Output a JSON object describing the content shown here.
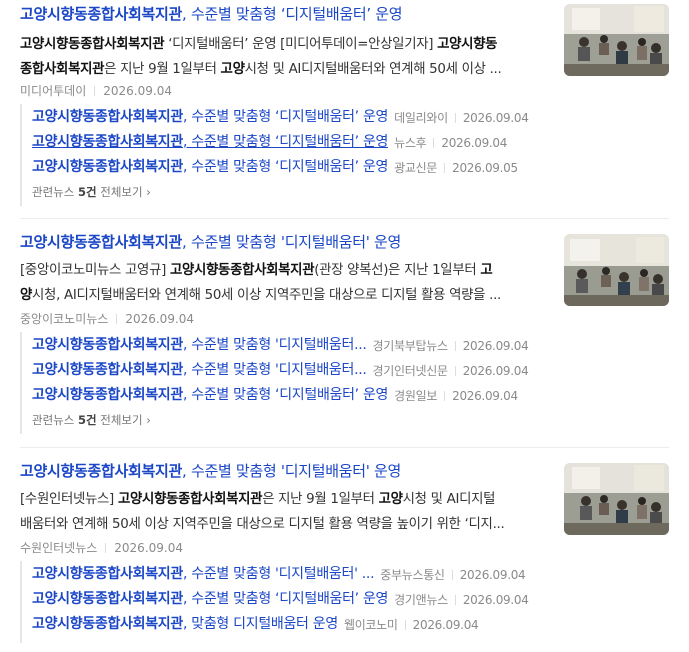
{
  "results": [
    {
      "title_strong": "고양시향동종합사회복지관",
      "title_rest": ", 수준별 맞춤형 ‘디지털배움터’ 운영",
      "desc_lines": [
        [
          [
            "b",
            "고양시향동종합사회복지관"
          ],
          [
            "t",
            " ‘디지털배움터’ 운영 [미디어투데이=안상일기자] "
          ],
          [
            "b",
            "고양시향동"
          ]
        ],
        [
          [
            "b",
            "종합사회복지관"
          ],
          [
            "t",
            "은 지난 9월 1일부터 "
          ],
          [
            "b",
            "고양"
          ],
          [
            "t",
            "시청 및 AI디지털배움터와 연계해 50세 이상 ..."
          ]
        ]
      ],
      "source": "미디어투데이",
      "date": "2026.09.04",
      "related": [
        {
          "strong": "고양시향동종합사회복지관",
          "rest": ", 수준별 맞춤형 ‘디지털배움터’ 운영",
          "src": "데일리와이",
          "date": "2026.09.04",
          "underline": false
        },
        {
          "strong": "고양시향동종합사회복지관",
          "rest": ", 수준별 맞춤형 ‘디지털배움터’ 운영",
          "src": "뉴스후",
          "date": "2026.09.04",
          "underline": true
        },
        {
          "strong": "고양시향동종합사회복지관",
          "rest": ", 수준별 맞춤형 ‘디지털배움터’ 운영",
          "src": "광교신문",
          "date": "2026.09.05",
          "underline": false
        }
      ],
      "more_prefix": "관련뉴스 ",
      "more_count": "5건",
      "more_suffix": " 전체보기"
    },
    {
      "title_strong": "고양시향동종합사회복지관",
      "title_rest": ", 수준별 맞춤형 '디지털배움터' 운영",
      "desc_lines": [
        [
          [
            "t",
            "[중앙이코노미뉴스 고영규] "
          ],
          [
            "b",
            "고양시향동종합사회복지관"
          ],
          [
            "t",
            "(관장 양복선)은 지난 1일부터 "
          ],
          [
            "b",
            "고"
          ]
        ],
        [
          [
            "b",
            "양"
          ],
          [
            "t",
            "시청, AI디지털배움터와 연계해 50세 이상 지역주민을 대상으로 디지털 활용 역량을 ..."
          ]
        ]
      ],
      "source": "중앙이코노미뉴스",
      "date": "2026.09.04",
      "related": [
        {
          "strong": "고양시향동종합사회복지관",
          "rest": ", 수준별 맞춤형 '디지털배움터...",
          "src": "경기북부탑뉴스",
          "date": "2026.09.04",
          "underline": false
        },
        {
          "strong": "고양시향동종합사회복지관",
          "rest": ", 수준별 맞춤형 '디지털배움터...",
          "src": "경기인터넷신문",
          "date": "2026.09.04",
          "underline": false
        },
        {
          "strong": "고양시향동종합사회복지관",
          "rest": ", 수준별 맞춤형 ‘디지털배움터’ 운영",
          "src": "경원일보",
          "date": "2026.09.04",
          "underline": false
        }
      ],
      "more_prefix": "관련뉴스 ",
      "more_count": "5건",
      "more_suffix": " 전체보기"
    },
    {
      "title_strong": "고양시향동종합사회복지관",
      "title_rest": ", 수준별 맞춤형 '디지털배움터' 운영",
      "desc_lines": [
        [
          [
            "t",
            "[수원인터넷뉴스] "
          ],
          [
            "b",
            "고양시향동종합사회복지관"
          ],
          [
            "t",
            "은 지난 9월 1일부터 "
          ],
          [
            "b",
            "고양"
          ],
          [
            "t",
            "시청 및 AI디지털"
          ]
        ],
        [
          [
            "t",
            "배움터와 연계해 50세 이상 지역주민을 대상으로 디지털 활용 역량을 높이기 위한 ‘디지..."
          ]
        ]
      ],
      "source": "수원인터넷뉴스",
      "date": "2026.09.04",
      "related": [
        {
          "strong": "고양시향동종합사회복지관",
          "rest": ", 수준별 맞춤형 '디지털배움터' ...",
          "src": "중부뉴스통신",
          "date": "2026.09.04",
          "underline": false
        },
        {
          "strong": "고양시향동종합사회복지관",
          "rest": ", 수준별 맞춤형 ‘디지털배움터’ 운영",
          "src": "경기앤뉴스",
          "date": "2026.09.04",
          "underline": false
        },
        {
          "strong": "고양시향동종합사회복지관",
          "rest": ", 맞춤형 디지털배움터 운영",
          "src": "웹이코노미",
          "date": "2026.09.04",
          "underline": false
        }
      ],
      "more_prefix": "",
      "more_count": "",
      "more_suffix": ""
    }
  ],
  "colors": {
    "link": "#1b47c7",
    "meta": "#8a8a8a"
  }
}
